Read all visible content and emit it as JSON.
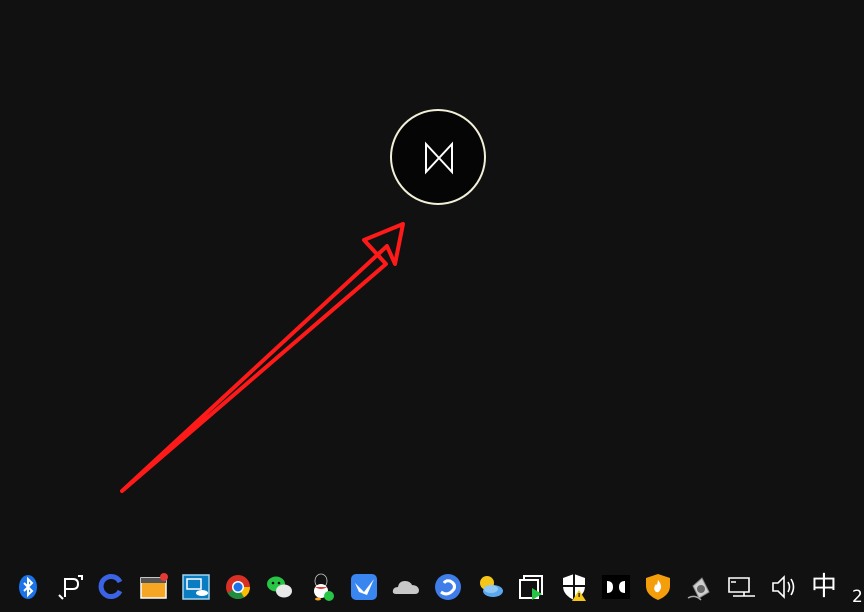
{
  "center_button": {
    "icon": "bowtie-toggle-icon",
    "border_color": "#f2f0d8"
  },
  "annotation": {
    "icon": "red-arrow-annotation",
    "color": "#ff1a1a"
  },
  "tray": {
    "icons": [
      {
        "name": "bluetooth-icon"
      },
      {
        "name": "pen-input-icon"
      },
      {
        "name": "loop-app-icon"
      },
      {
        "name": "window-notification-icon"
      },
      {
        "name": "intel-graphics-icon"
      },
      {
        "name": "chrome-icon"
      },
      {
        "name": "wechat-icon"
      },
      {
        "name": "qq-icon"
      },
      {
        "name": "bird-app-icon"
      },
      {
        "name": "onedrive-cloud-icon"
      },
      {
        "name": "blue-swirl-app-icon"
      },
      {
        "name": "weather-sun-icon"
      },
      {
        "name": "cast-play-icon"
      },
      {
        "name": "security-warning-icon"
      },
      {
        "name": "dolby-icon"
      },
      {
        "name": "fire-shield-icon"
      },
      {
        "name": "speaker-device-icon"
      },
      {
        "name": "network-icon"
      },
      {
        "name": "volume-icon"
      }
    ],
    "ime_label": "中",
    "clock_text": "2"
  }
}
